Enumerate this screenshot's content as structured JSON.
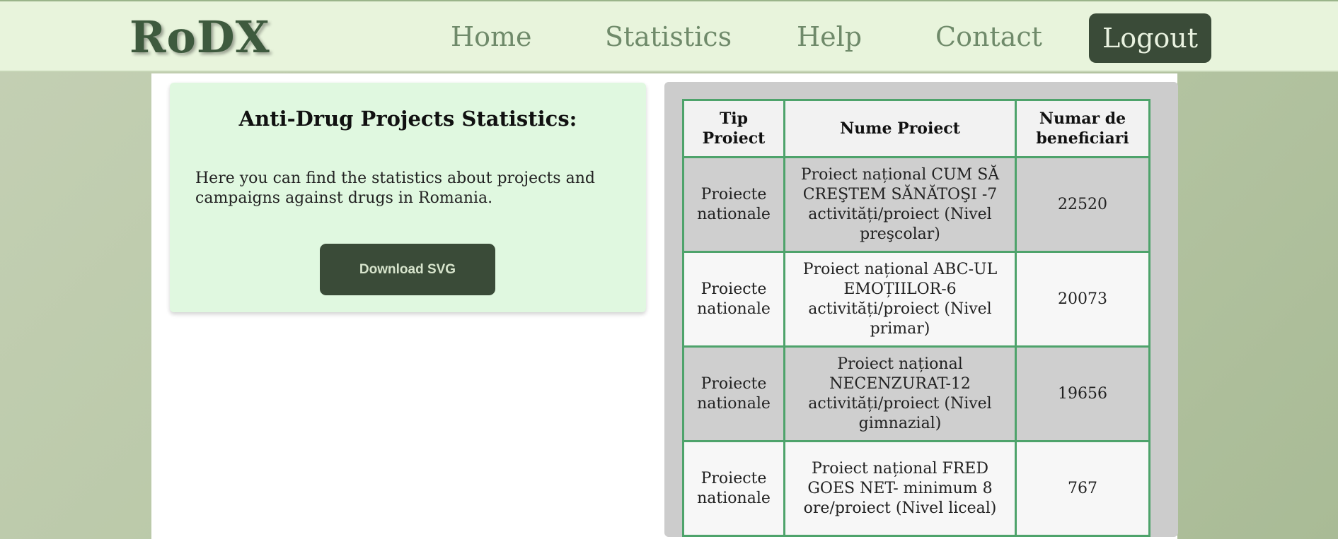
{
  "header": {
    "logo": "RoDX",
    "nav": [
      "Home",
      "Statistics",
      "Help",
      "Contact"
    ],
    "logout": "Logout"
  },
  "info_card": {
    "title": "Anti-Drug Projects Statistics:",
    "description": "Here you can find the statistics about projects and campaigns against drugs in Romania.",
    "download_label": "Download SVG"
  },
  "table": {
    "headers": [
      "Tip Proiect",
      "Nume Proiect",
      "Numar de beneficiari"
    ],
    "rows": [
      [
        "Proiecte nationale",
        "Proiect național CUM SĂ CREŞTEM SĂNĂTOŞI -7 activități/proiect (Nivel preşcolar)",
        "22520"
      ],
      [
        "Proiecte nationale",
        "Proiect național ABC-UL EMOȚIILOR-6 activități/proiect (Nivel primar)",
        "20073"
      ],
      [
        "Proiecte nationale",
        "Proiect național NECENZURAT-12 activități/proiect (Nivel gimnazial)",
        "19656"
      ],
      [
        "Proiecte nationale",
        "Proiect național FRED GOES NET- minimum 8 ore/proiect (Nivel liceal)",
        "767"
      ]
    ]
  },
  "colors": {
    "accent_dark": "#3a4b38",
    "topbar_bg": "#e8f4dc",
    "card_bg": "#e0f8e0",
    "table_border": "#4ea36b"
  }
}
